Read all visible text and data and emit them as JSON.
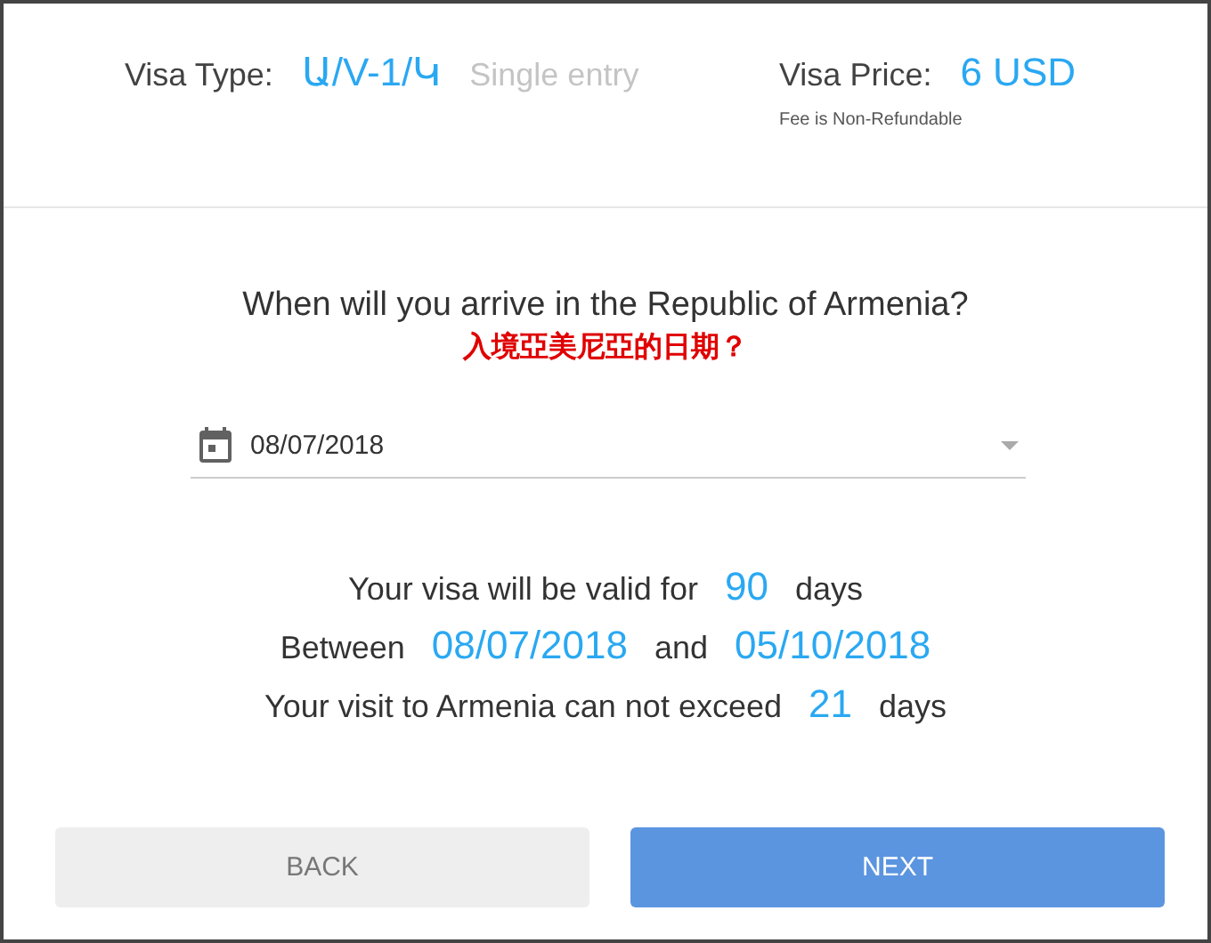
{
  "header": {
    "visa_type_label": "Visa Type:",
    "visa_type": "Ա/V-1/Կ",
    "entry": "Single entry",
    "price_label": "Visa Price:",
    "price": "6 USD",
    "fee_note": "Fee is Non-Refundable"
  },
  "question": "When will you arrive in the Republic of Armenia?",
  "annotation": "入境亞美尼亞的日期？",
  "date_field": {
    "value": "08/07/2018"
  },
  "validity": {
    "valid_prefix": "Your visa will be valid for",
    "valid_days": "90",
    "valid_suffix": "days",
    "between_label": "Between",
    "start": "08/07/2018",
    "and_label": "and",
    "end": "05/10/2018",
    "visit_prefix": "Your visit to Armenia can not exceed",
    "visit_days": "21",
    "visit_suffix": "days"
  },
  "buttons": [
    {
      "label": "BACK",
      "kind": "secondary"
    },
    {
      "label": "NEXT",
      "kind": "primary"
    }
  ]
}
